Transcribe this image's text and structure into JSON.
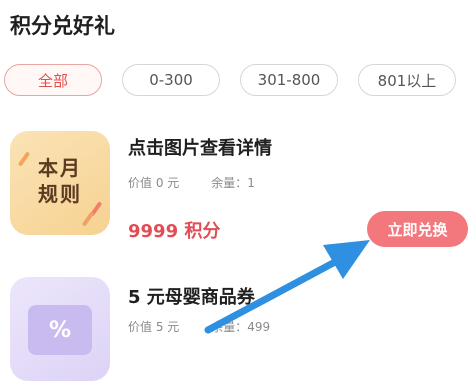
{
  "page": {
    "title": "积分兑好礼"
  },
  "filters": [
    {
      "label": "全部",
      "active": true
    },
    {
      "label": "0-300",
      "active": false
    },
    {
      "label": "301-800",
      "active": false
    },
    {
      "label": "801以上",
      "active": false
    }
  ],
  "items": [
    {
      "thumb_text_line1": "本月",
      "thumb_text_line2": "规则",
      "name": "点击图片查看详情",
      "value_label": "价值 0 元",
      "stock_label": "余量：1",
      "points_label": "9999 积分",
      "redeem_label": "立即兑换"
    },
    {
      "thumb_icon": "%",
      "name": "5 元母婴商品券",
      "value_label": "价值 5 元",
      "stock_label": "余量：499"
    }
  ],
  "colors": {
    "accent": "#e24d55",
    "button": "#f2787d",
    "arrow": "#2f8fe0"
  }
}
